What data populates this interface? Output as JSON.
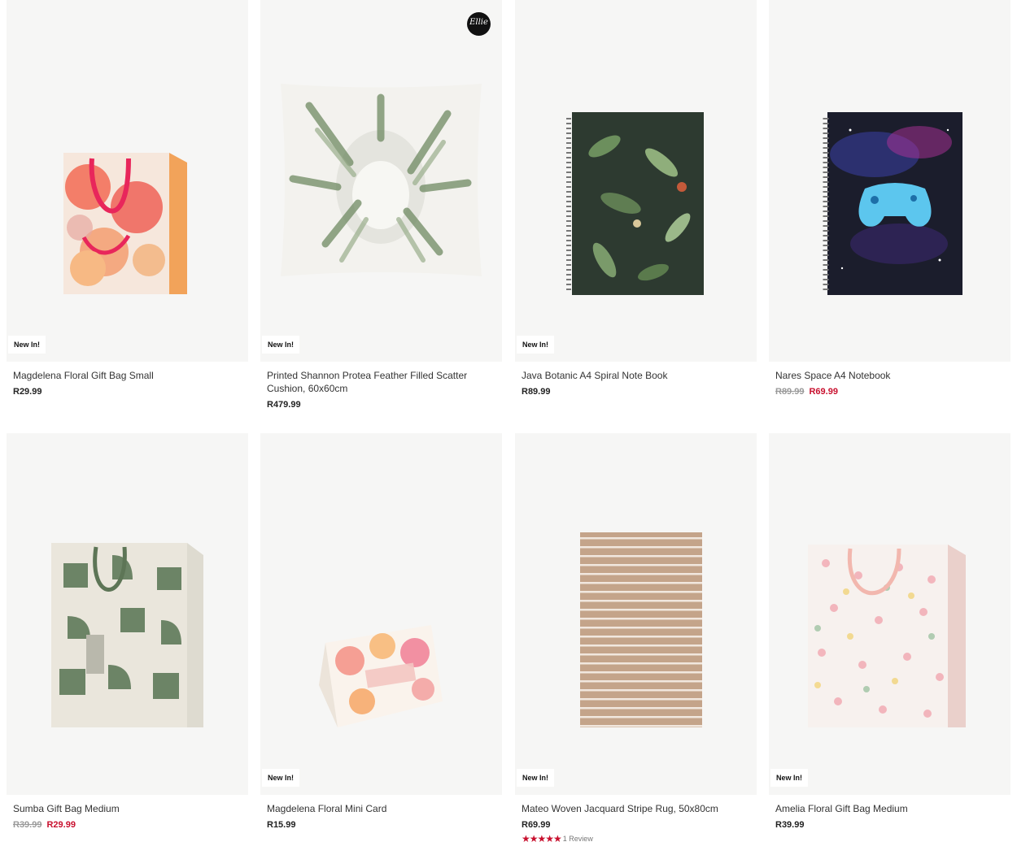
{
  "products": [
    {
      "title": "Magdelena Floral Gift Bag Small",
      "badge": "New In!",
      "price": "R29.99",
      "image": "floral-gift-bag-small"
    },
    {
      "title": "Printed Shannon Protea Feather Filled Scatter Cushion, 60x60cm",
      "badge": "New In!",
      "price": "R479.99",
      "brand_mark": "Ellie",
      "image": "protea-cushion"
    },
    {
      "title": "Java Botanic A4 Spiral Note Book",
      "badge": "New In!",
      "price": "R89.99",
      "image": "botanic-notebook"
    },
    {
      "title": "Nares Space A4 Notebook",
      "old_price": "R89.99",
      "sale_price": "R69.99",
      "image": "space-notebook"
    },
    {
      "title": "Sumba Gift Bag Medium",
      "old_price": "R39.99",
      "sale_price": "R29.99",
      "image": "green-gift-bag"
    },
    {
      "title": "Magdelena Floral Mini Card",
      "badge": "New In!",
      "price": "R15.99",
      "image": "floral-mini-card"
    },
    {
      "title": "Mateo Woven Jacquard Stripe Rug, 50x80cm",
      "badge": "New In!",
      "price": "R69.99",
      "rating_stars": 5,
      "reviews": "1 Review",
      "image": "stripe-rug"
    },
    {
      "title": "Amelia Floral Gift Bag Medium",
      "badge": "New In!",
      "price": "R39.99",
      "image": "pink-floral-gift-bag"
    }
  ],
  "colors": {
    "sale": "#c8102e",
    "card_bg": "#f6f6f5",
    "old_price": "#9a9a9a"
  }
}
